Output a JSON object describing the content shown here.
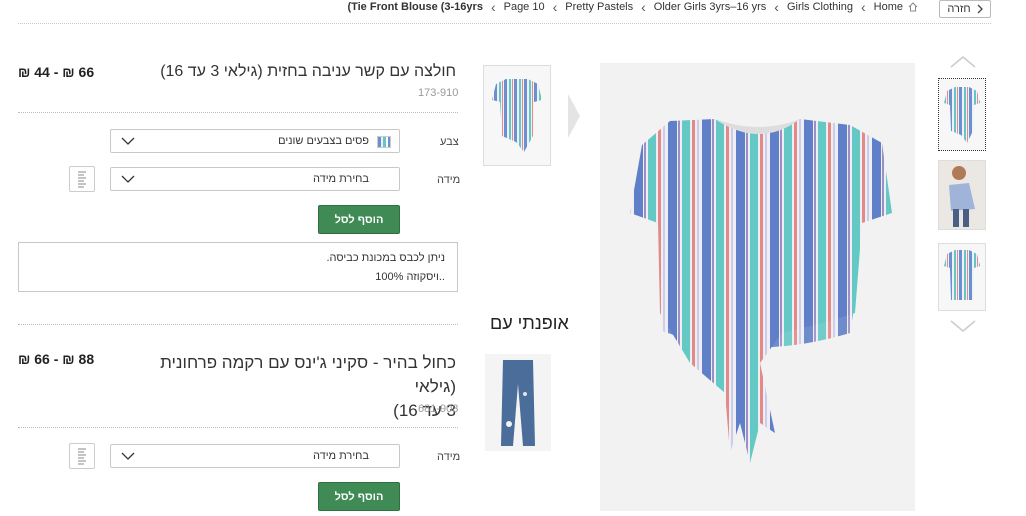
{
  "topbar": {
    "back_label": "חזרה",
    "breadcrumbs": [
      "Home",
      "Girls Clothing",
      "Older Girls 3yrs–16 yrs",
      "Pretty Pastels",
      "Page 10",
      "(Tie Front Blouse (3-16yrs"
    ]
  },
  "gallery": {
    "up_icon": "chevron-up-icon",
    "down_icon": "chevron-down-icon"
  },
  "wear_with": {
    "title": "אופנתי עם"
  },
  "product1": {
    "title": "חולצה עם קשר עניבה בחזית (גילאי 3 עד 16)",
    "code": "173-910",
    "price": "₪ 44 - ₪ 66",
    "colour_label": "צבע",
    "colour_value": "פסים בצבעים שונים",
    "size_label": "מידה",
    "size_placeholder": "בחירת מידה",
    "add_label": "הוסף לסל",
    "info_line1": "ניתן לכבס במכונת כביסה.",
    "info_line2": "100% ויסקוזה.."
  },
  "product2": {
    "title_line1": "כחול בהיר - סקיני ג'ינס עם רקמה פרחונית (גילאי",
    "title_line2": "3 עד 16)",
    "code": "681-903",
    "price": "₪ 66 - ₪ 88",
    "size_label": "מידה",
    "size_placeholder": "בחירת מידה",
    "add_label": "הוסף לסל"
  },
  "colors": {
    "add_green": "#3f8a55",
    "border": "#c8c8c8"
  }
}
